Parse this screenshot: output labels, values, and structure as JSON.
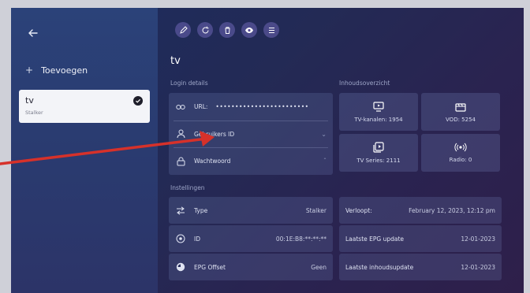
{
  "sidebar": {
    "back_icon": "arrow-left-icon",
    "add_label": "Toevoegen",
    "playlist": {
      "name": "tv",
      "type": "Stalker"
    }
  },
  "toolbar": {
    "icons": [
      "pencil-icon",
      "refresh-icon",
      "trash-icon",
      "eye-icon",
      "list-icon"
    ]
  },
  "main": {
    "title": "tv",
    "login_section": "Login details",
    "login": {
      "url_label": "URL:",
      "url_value": "••••••••••••••••••••••••",
      "username_label": "Gebruikers ID",
      "password_label": "Wachtwoord"
    },
    "content_section": "Inhoudsoverzicht",
    "content": {
      "tv_channels": "TV-kanalen: 1954",
      "vod": "VOD: 5254",
      "tv_series": "TV Series: 2111",
      "radio": "Radio: 0"
    },
    "settings_section": "Instellingen",
    "settings": {
      "type_label": "Type",
      "type_value": "Stalker",
      "id_label": "ID",
      "id_value": "00:1E:B8:**:**:**",
      "epg_label": "EPG Offset",
      "epg_value": "Geen"
    },
    "info": {
      "expires_label": "Verloopt:",
      "expires_value": "February 12, 2023, 12:12 pm",
      "epg_update_label": "Laatste EPG update",
      "epg_update_value": "12-01-2023",
      "content_update_label": "Laatste inhoudsupdate",
      "content_update_value": "12-01-2023"
    }
  },
  "colors": {
    "annotation_arrow": "#d6312a"
  }
}
